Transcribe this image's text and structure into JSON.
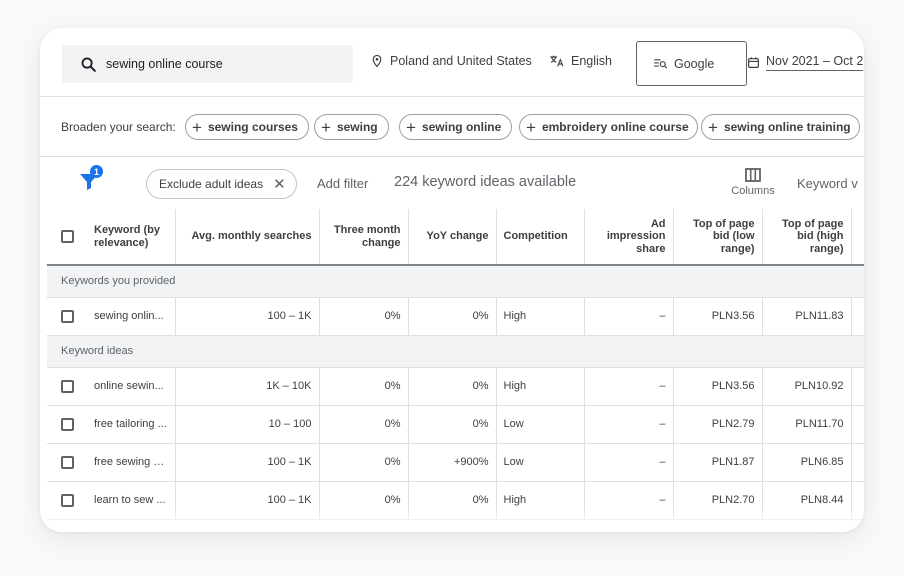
{
  "search": {
    "query": "sewing online course"
  },
  "targeting": {
    "location": "Poland and United States",
    "language": "English",
    "network": "Google",
    "date_range": "Nov 2021 – Oct 2"
  },
  "broaden": {
    "label": "Broaden your search:",
    "chips": [
      "sewing courses",
      "sewing",
      "sewing online",
      "embroidery online course",
      "sewing online training"
    ]
  },
  "filters": {
    "badge_count": "1",
    "exclude_chip": "Exclude adult ideas",
    "add_filter": "Add filter",
    "available": "224 keyword ideas available",
    "columns": "Columns",
    "keyword_view": "Keyword v"
  },
  "table": {
    "headers": {
      "keyword": "Keyword (by relevance)",
      "avg": "Avg. monthly searches",
      "three_month": "Three month change",
      "yoy": "YoY change",
      "competition": "Competition",
      "ad_share": "Ad impression share",
      "bid_low": "Top of page bid (low range)",
      "bid_high": "Top of page bid (high range)"
    },
    "group_provided": "Keywords you provided",
    "provided": [
      {
        "keyword": "sewing onlin...",
        "avg": "100 – 1K",
        "three_month": "0%",
        "yoy": "0%",
        "competition": "High",
        "ad_share": "–",
        "bid_low": "PLN3.56",
        "bid_high": "PLN11.83"
      }
    ],
    "group_ideas": "Keyword ideas",
    "ideas": [
      {
        "keyword": "online sewin...",
        "avg": "1K – 10K",
        "three_month": "0%",
        "yoy": "0%",
        "competition": "High",
        "ad_share": "–",
        "bid_low": "PLN3.56",
        "bid_high": "PLN10.92"
      },
      {
        "keyword": "free tailoring ...",
        "avg": "10 – 100",
        "three_month": "0%",
        "yoy": "0%",
        "competition": "Low",
        "ad_share": "–",
        "bid_low": "PLN2.79",
        "bid_high": "PLN11.70"
      },
      {
        "keyword": "free sewing c...",
        "avg": "100 – 1K",
        "three_month": "0%",
        "yoy": "+900%",
        "competition": "Low",
        "ad_share": "–",
        "bid_low": "PLN1.87",
        "bid_high": "PLN6.85"
      },
      {
        "keyword": "learn to sew ...",
        "avg": "100 – 1K",
        "three_month": "0%",
        "yoy": "0%",
        "competition": "High",
        "ad_share": "–",
        "bid_low": "PLN2.70",
        "bid_high": "PLN8.44"
      }
    ]
  },
  "colors": {
    "accent": "#1a73e8",
    "group_bg": "#f1f3f4",
    "search_bg": "#f1f3f4"
  }
}
